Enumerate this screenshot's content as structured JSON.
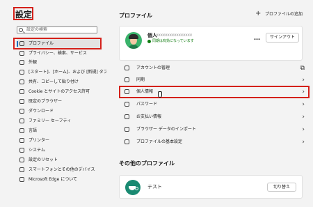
{
  "sidebar": {
    "title": "設定",
    "search_placeholder": "設定の検索",
    "items": [
      {
        "label": "プロファイル",
        "active": true
      },
      {
        "label": "プライバシー、検索、サービス"
      },
      {
        "label": "外観"
      },
      {
        "label": "[スタート]、[ホーム]、および [新規] タブ"
      },
      {
        "label": "共有、コピーして貼り付け"
      },
      {
        "label": "Cookie とサイトのアクセス許可"
      },
      {
        "label": "既定のブラウザー"
      },
      {
        "label": "ダウンロード"
      },
      {
        "label": "ファミリー セーフティ"
      },
      {
        "label": "言語"
      },
      {
        "label": "プリンター"
      },
      {
        "label": "システム"
      },
      {
        "label": "設定のリセット"
      },
      {
        "label": "スマートフォンとその他のデバイス"
      },
      {
        "label": "Microsoft Edge について"
      }
    ]
  },
  "main": {
    "title": "プロファイル",
    "add_profile": "プロファイルの追加",
    "profile": {
      "name": "個人",
      "email": "xxxxxxxxxxxxxxxx",
      "sync_status": "同期は有効になっています",
      "more": "…",
      "signout": "サインアウト"
    },
    "rows": [
      {
        "label": "アカウントの管理",
        "arrow": "⧉"
      },
      {
        "label": "同期",
        "arrow": "›"
      },
      {
        "label": "個人情報",
        "arrow": "›"
      },
      {
        "label": "パスワード",
        "arrow": "›"
      },
      {
        "label": "お支払い情報",
        "arrow": "›"
      },
      {
        "label": "ブラウザー データのインポート",
        "arrow": "›"
      },
      {
        "label": "プロファイルの基本設定",
        "arrow": "›"
      }
    ],
    "other_title": "その他のプロファイル",
    "other_profile": {
      "name": "テスト",
      "switch": "切り替え"
    }
  },
  "accent_colors": {
    "highlight": "#d4201a",
    "accent": "#0f6cbd",
    "sync": "#107c10"
  }
}
